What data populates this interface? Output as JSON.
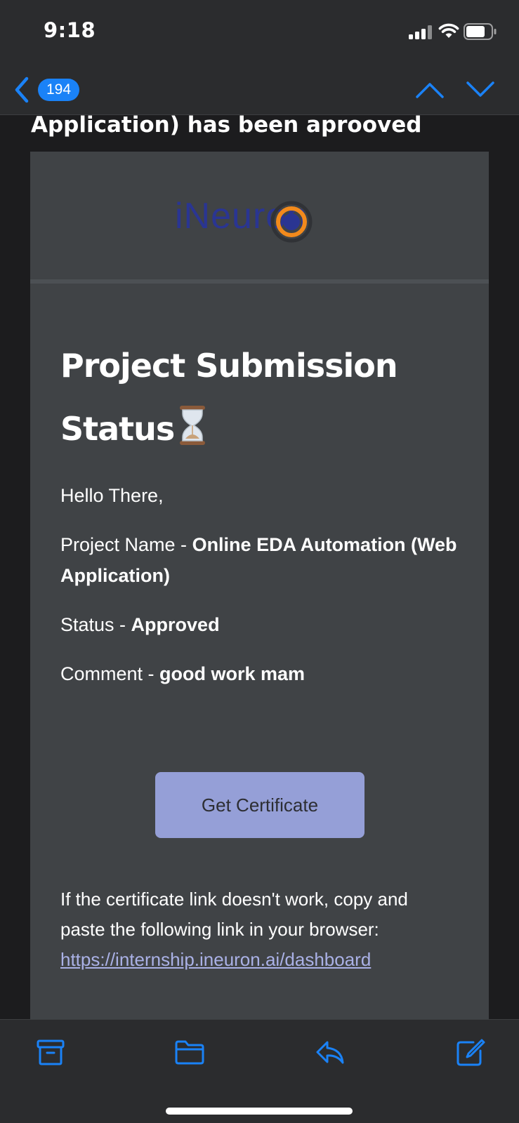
{
  "status_bar": {
    "time": "9:18"
  },
  "nav": {
    "unread_count": "194"
  },
  "email": {
    "subject_visible": "Application) has been aprooved",
    "logo_text": "iNeuron",
    "heading": "Project Submission Status",
    "greeting": "Hello There,",
    "project_label": "Project Name - ",
    "project_value": "Online EDA Automation (Web Application)",
    "status_label": "Status - ",
    "status_value": "Approved",
    "comment_label": "Comment - ",
    "comment_value": "good work mam",
    "button_label": "Get Certificate",
    "fallback_text": "If the certificate link doesn't work, copy and paste the following link in your browser:",
    "fallback_link": "https://internship.ineuron.ai/dashboard"
  },
  "colors": {
    "accent": "#1a82f7",
    "card_bg": "#404346",
    "button_bg": "#959fd7",
    "logo_blue": "#2a3592",
    "logo_orange": "#f28a1c"
  },
  "icons": [
    "back-chevron-icon",
    "chevron-up-icon",
    "chevron-down-icon",
    "archive-icon",
    "folder-icon",
    "reply-icon",
    "compose-icon",
    "hourglass-icon"
  ]
}
